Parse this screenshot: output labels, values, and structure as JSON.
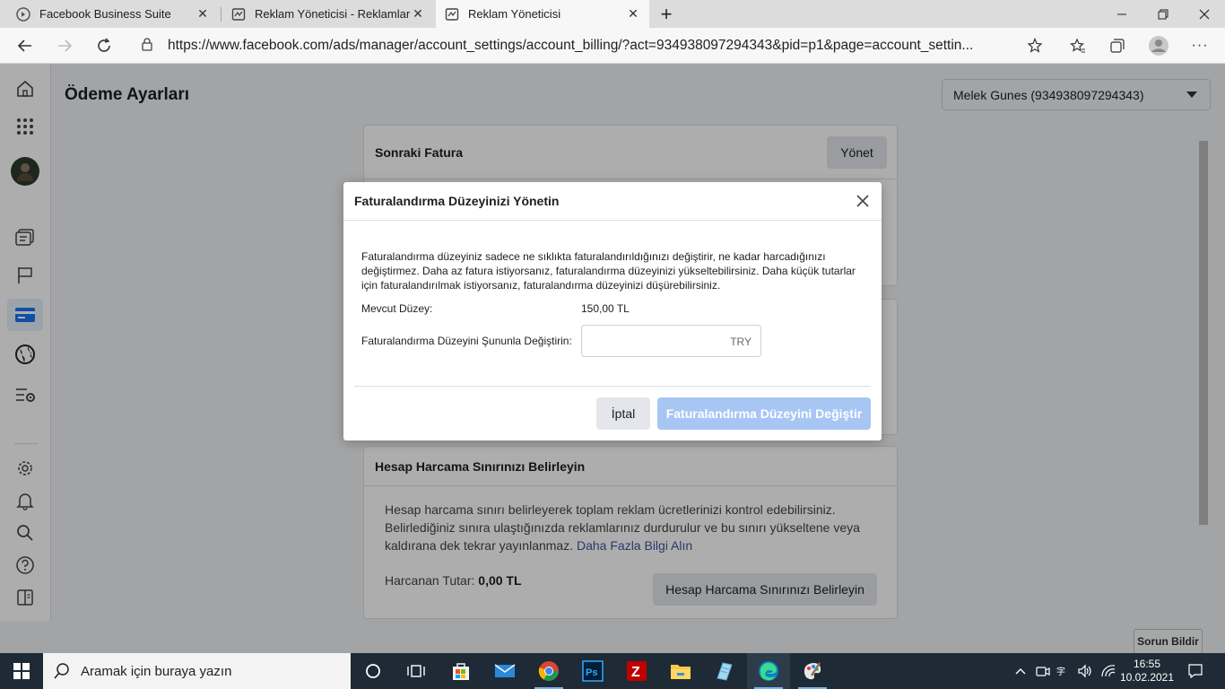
{
  "browser": {
    "tabs": [
      {
        "title": "Facebook Business Suite",
        "close": "✕"
      },
      {
        "title": "Reklam Yöneticisi - Reklamları Yö",
        "close": "✕"
      },
      {
        "title": "Reklam Yöneticisi",
        "close": "✕"
      }
    ],
    "new_tab": "+",
    "url": "https://www.facebook.com/ads/manager/account_settings/account_billing/?act=934938097294343&pid=p1&page=account_settin..."
  },
  "page": {
    "title": "Ödeme Ayarları",
    "account_selector": "Melek Gunes (934938097294343)",
    "next_invoice": {
      "title": "Sonraki Fatura",
      "manage_label": "Yönet"
    },
    "spending_limit": {
      "title": "Hesap Harcama Sınırınızı Belirleyin",
      "description": "Hesap harcama sınırı belirleyerek toplam reklam ücretlerinizi kontrol edebilirsiniz. Belirlediğiniz sınıra ulaştığınızda reklamlarınız durdurulur ve bu sınırı yükseltene veya kaldırana dek tekrar yayınlanmaz.",
      "learn_more": "Daha Fazla Bilgi Alın",
      "spent_label": "Harcanan Tutar:",
      "spent_value": "0,00 TL",
      "button_label": "Hesap Harcama Sınırınızı Belirleyin"
    },
    "report_issue": "Sorun Bildir"
  },
  "modal": {
    "title": "Faturalandırma Düzeyinizi Yönetin",
    "description": "Faturalandırma düzeyiniz sadece ne sıklıkta faturalandırıldığınızı değiştirir, ne kadar harcadığınızı değiştirmez. Daha az fatura istiyorsanız, faturalandırma düzeyinizi yükseltebilirsiniz. Daha küçük tutarlar için faturalandırılmak istiyorsanız, faturalandırma düzeyinizi düşürebilirsiniz.",
    "current_label": "Mevcut Düzey:",
    "current_value": "150,00 TL",
    "change_label": "Faturalandırma Düzeyini Şununla Değiştirin:",
    "input_value": "",
    "currency": "TRY",
    "cancel_label": "İptal",
    "submit_label": "Faturalandırma Düzeyini Değiştir"
  },
  "taskbar": {
    "search_placeholder": "Aramak için buraya yazın",
    "time": "16:55",
    "date": "10.02.2021"
  },
  "colors": {
    "accent": "#1877f2",
    "disabled_button": "#a8c6f4",
    "link": "#385898"
  }
}
